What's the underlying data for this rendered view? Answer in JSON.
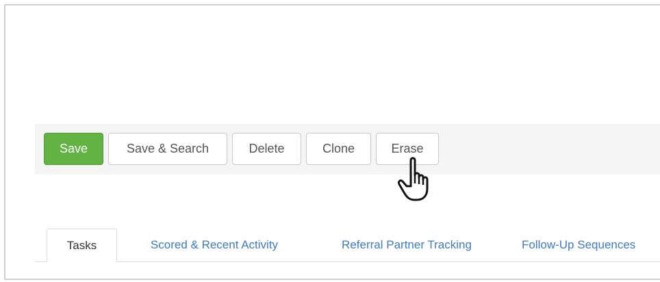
{
  "toolbar": {
    "buttons": [
      {
        "label": "Save"
      },
      {
        "label": "Save & Search"
      },
      {
        "label": "Delete"
      },
      {
        "label": "Clone"
      },
      {
        "label": "Erase"
      }
    ]
  },
  "tabs": [
    {
      "label": "Tasks",
      "active": true
    },
    {
      "label": "Scored & Recent Activity",
      "active": false
    },
    {
      "label": "Referral Partner Tracking",
      "active": false
    },
    {
      "label": "Follow-Up Sequences",
      "active": false
    }
  ],
  "colors": {
    "primary_button": "#62b343",
    "tab_link": "#3b7cc4"
  },
  "cursor": {
    "icon": "hand-pointer-icon"
  }
}
